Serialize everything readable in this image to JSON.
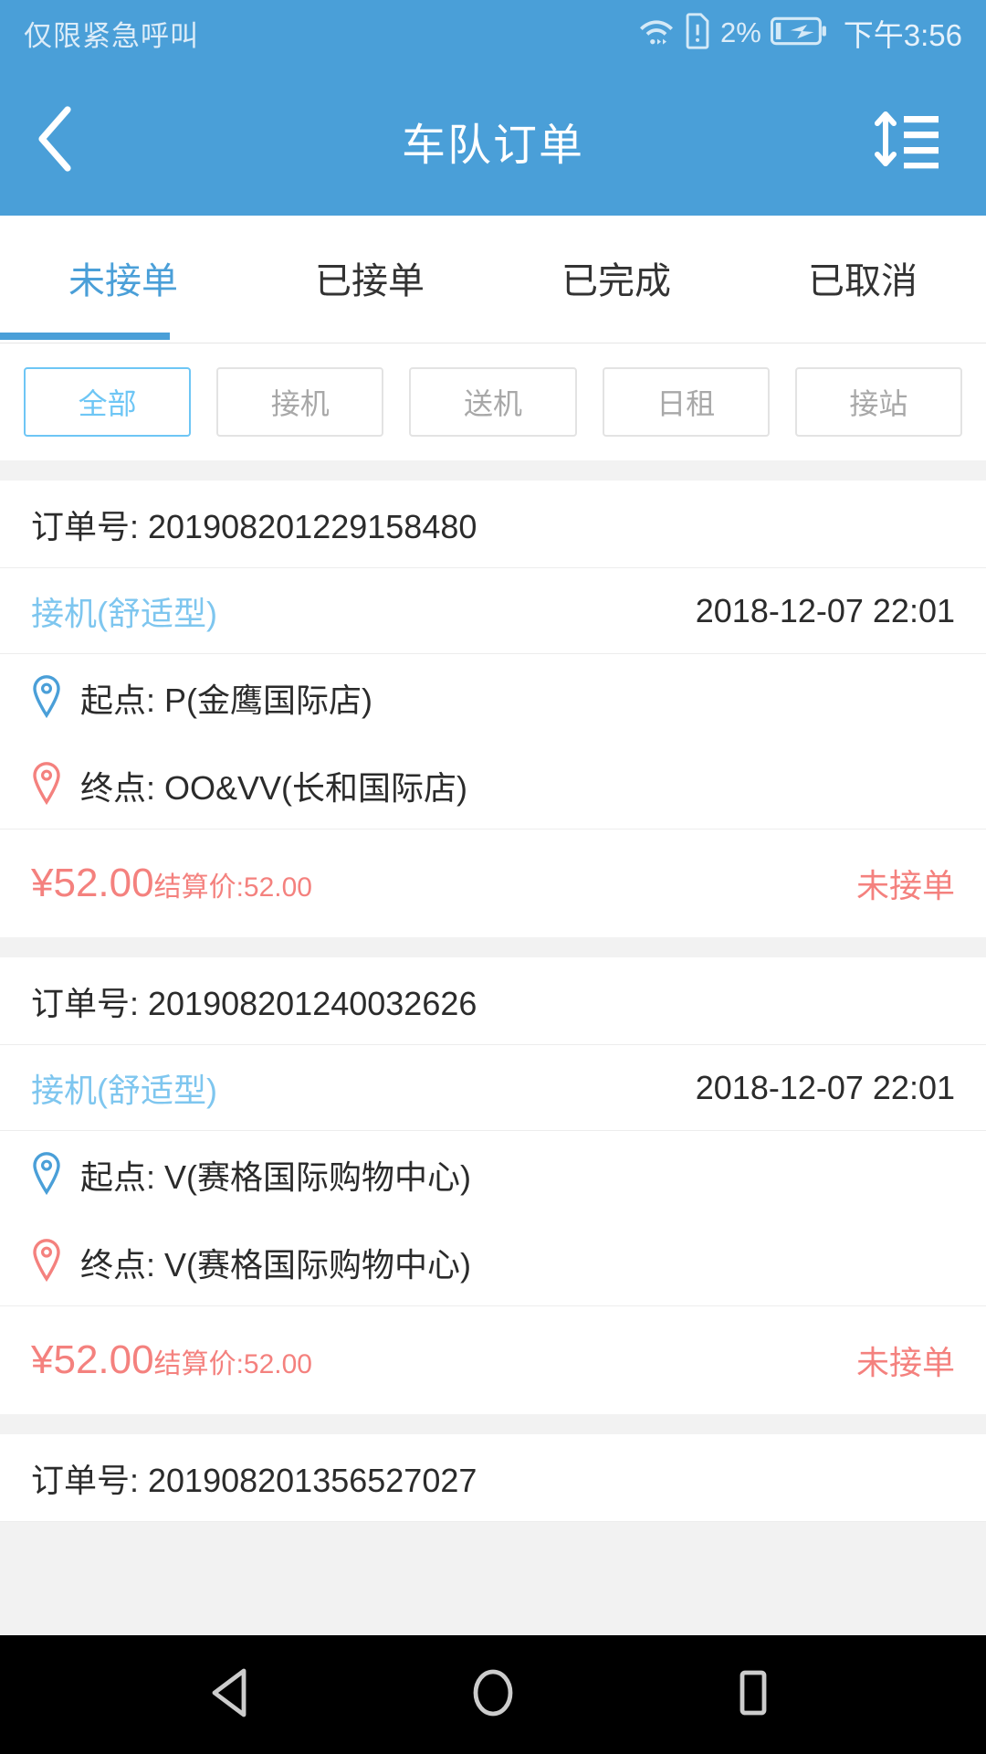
{
  "statusbar": {
    "carrier": "仅限紧急呼叫",
    "battery_percent": "2%",
    "time": "下午3:56",
    "icons": [
      "wifi-icon",
      "sim-alert-icon",
      "battery-charging-icon"
    ]
  },
  "appbar": {
    "title": "车队订单",
    "back_icon": "chevron-left-icon",
    "sort_icon": "sort-icon"
  },
  "tabs": [
    {
      "label": "未接单",
      "active": true
    },
    {
      "label": "已接单",
      "active": false
    },
    {
      "label": "已完成",
      "active": false
    },
    {
      "label": "已取消",
      "active": false
    }
  ],
  "filters": [
    {
      "label": "全部",
      "active": true
    },
    {
      "label": "接机",
      "active": false
    },
    {
      "label": "送机",
      "active": false
    },
    {
      "label": "日租",
      "active": false
    },
    {
      "label": "接站",
      "active": false
    }
  ],
  "labels": {
    "order_prefix": "订单号:",
    "origin_prefix": "起点:",
    "destination_prefix": "终点:",
    "settlement_prefix": "结算价:",
    "currency": "¥"
  },
  "orders": [
    {
      "order_no": "订单号: 201908201229158480",
      "type": "接机(舒适型)",
      "date": "2018-12-07 22:01",
      "origin": "起点: P(金鹰国际店)",
      "destination": "终点: OO&VV(长和国际店)",
      "price": "¥52.00",
      "settlement": "结算价:52.00",
      "status": "未接单"
    },
    {
      "order_no": "订单号: 201908201240032626",
      "type": "接机(舒适型)",
      "date": "2018-12-07 22:01",
      "origin": "起点: V(赛格国际购物中心)",
      "destination": "终点: V(赛格国际购物中心)",
      "price": "¥52.00",
      "settlement": "结算价:52.00",
      "status": "未接单"
    },
    {
      "order_no": "订单号: 201908201356527027",
      "type": "",
      "date": "",
      "origin": "",
      "destination": "",
      "price": "",
      "settlement": "",
      "status": ""
    }
  ],
  "navbar": {
    "back_icon": "android-back-icon",
    "home_icon": "android-home-icon",
    "recents_icon": "android-recents-icon"
  },
  "colors": {
    "brand_blue": "#4a9fd8",
    "accent_blue": "#7ec6ef",
    "price_red": "#f4817e",
    "pin_blue": "#4a9fd8",
    "pin_red": "#f4817e",
    "page_bg": "#f2f2f2"
  }
}
